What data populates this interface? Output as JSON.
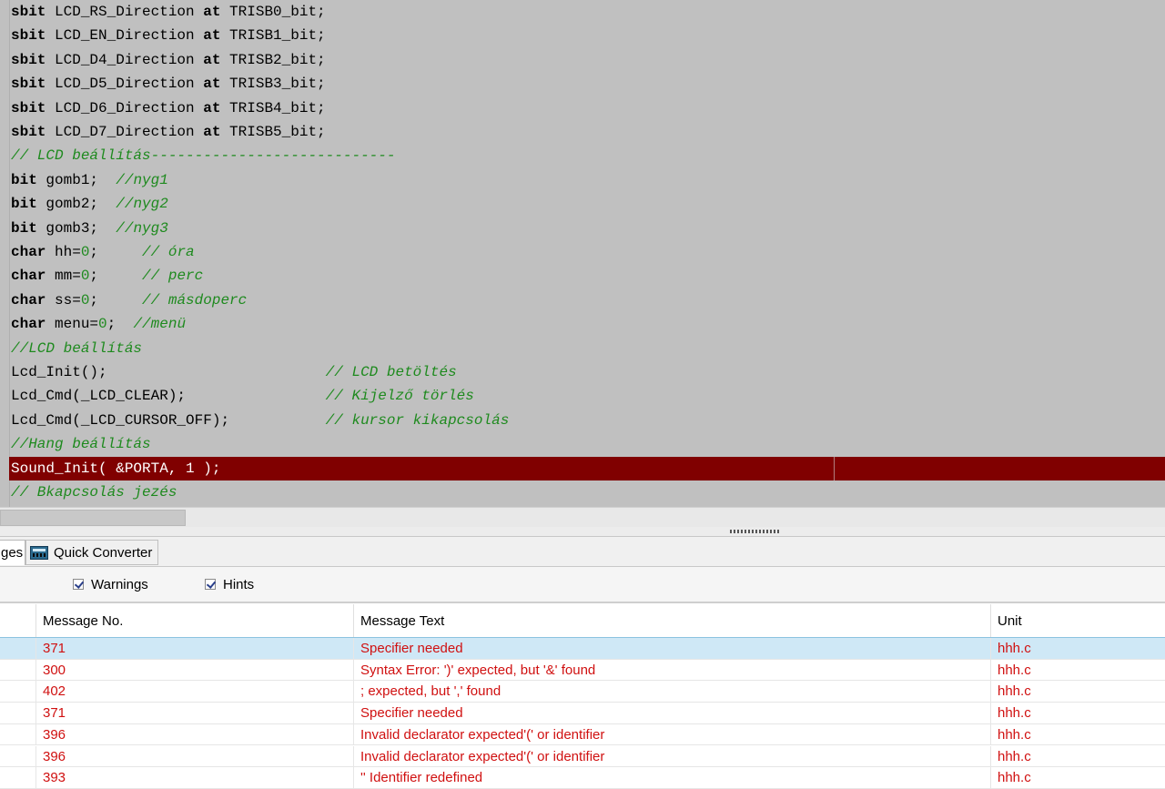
{
  "editor": {
    "lines": [
      [
        {
          "t": "sbit",
          "c": "kw"
        },
        {
          "t": " LCD_RS_Direction "
        },
        {
          "t": "at",
          "c": "kw"
        },
        {
          "t": " TRISB0_bit;"
        }
      ],
      [
        {
          "t": "sbit",
          "c": "kw"
        },
        {
          "t": " LCD_EN_Direction "
        },
        {
          "t": "at",
          "c": "kw"
        },
        {
          "t": " TRISB1_bit;"
        }
      ],
      [
        {
          "t": "sbit",
          "c": "kw"
        },
        {
          "t": " LCD_D4_Direction "
        },
        {
          "t": "at",
          "c": "kw"
        },
        {
          "t": " TRISB2_bit;"
        }
      ],
      [
        {
          "t": "sbit",
          "c": "kw"
        },
        {
          "t": " LCD_D5_Direction "
        },
        {
          "t": "at",
          "c": "kw"
        },
        {
          "t": " TRISB3_bit;"
        }
      ],
      [
        {
          "t": "sbit",
          "c": "kw"
        },
        {
          "t": " LCD_D6_Direction "
        },
        {
          "t": "at",
          "c": "kw"
        },
        {
          "t": " TRISB4_bit;"
        }
      ],
      [
        {
          "t": "sbit",
          "c": "kw"
        },
        {
          "t": " LCD_D7_Direction "
        },
        {
          "t": "at",
          "c": "kw"
        },
        {
          "t": " TRISB5_bit;"
        }
      ],
      [
        {
          "t": "// LCD beállítás----------------------------",
          "c": "cm"
        }
      ],
      [
        {
          "t": "bit",
          "c": "kw"
        },
        {
          "t": " gomb1;  "
        },
        {
          "t": "//nyg1",
          "c": "cm"
        }
      ],
      [
        {
          "t": "bit",
          "c": "kw"
        },
        {
          "t": " gomb2;  "
        },
        {
          "t": "//nyg2",
          "c": "cm"
        }
      ],
      [
        {
          "t": "bit",
          "c": "kw"
        },
        {
          "t": " gomb3;  "
        },
        {
          "t": "//nyg3",
          "c": "cm"
        }
      ],
      [
        {
          "t": "char",
          "c": "kw"
        },
        {
          "t": " hh="
        },
        {
          "t": "0",
          "c": "num"
        },
        {
          "t": ";     "
        },
        {
          "t": "// óra",
          "c": "cm"
        }
      ],
      [
        {
          "t": "char",
          "c": "kw"
        },
        {
          "t": " mm="
        },
        {
          "t": "0",
          "c": "num"
        },
        {
          "t": ";     "
        },
        {
          "t": "// perc",
          "c": "cm"
        }
      ],
      [
        {
          "t": "char",
          "c": "kw"
        },
        {
          "t": " ss="
        },
        {
          "t": "0",
          "c": "num"
        },
        {
          "t": ";     "
        },
        {
          "t": "// másdoperc",
          "c": "cm"
        }
      ],
      [
        {
          "t": "char",
          "c": "kw"
        },
        {
          "t": " menu="
        },
        {
          "t": "0",
          "c": "num"
        },
        {
          "t": ";  "
        },
        {
          "t": "//menü",
          "c": "cm"
        }
      ],
      [
        {
          "t": "//LCD beállítás",
          "c": "cm"
        }
      ],
      [
        {
          "t": "Lcd_Init();                         "
        },
        {
          "t": "// LCD betöltés",
          "c": "cm"
        }
      ],
      [
        {
          "t": "Lcd_Cmd(_LCD_CLEAR);                "
        },
        {
          "t": "// Kijelző törlés",
          "c": "cm"
        }
      ],
      [
        {
          "t": "Lcd_Cmd(_LCD_CURSOR_OFF);           "
        },
        {
          "t": "// kursor kikapcsolás",
          "c": "cm"
        }
      ],
      [
        {
          "t": "//Hang beállítás",
          "c": "cm"
        }
      ],
      [
        {
          "t": "Sound_Init( &PORTA, 1 );"
        }
      ],
      [
        {
          "t": "// Bkapcsolás jezés",
          "c": "cm"
        }
      ]
    ],
    "active_line": 19
  },
  "tabs": {
    "messages_label": "ges",
    "quick_converter_label": "Quick Converter"
  },
  "filters": {
    "warnings_label": "Warnings",
    "hints_label": "Hints"
  },
  "messages": {
    "columns": [
      "Message No.",
      "Message Text",
      "Unit"
    ],
    "rows": [
      {
        "no": "371",
        "text": "Specifier needed",
        "unit": "hhh.c"
      },
      {
        "no": "300",
        "text": "Syntax Error: ')' expected,  but '&' found",
        "unit": "hhh.c"
      },
      {
        "no": "402",
        "text": "; expected, but ',' found",
        "unit": "hhh.c"
      },
      {
        "no": "371",
        "text": "Specifier needed",
        "unit": "hhh.c"
      },
      {
        "no": "396",
        "text": "Invalid declarator expected'(' or identifier",
        "unit": "hhh.c"
      },
      {
        "no": "396",
        "text": "Invalid declarator expected'(' or identifier",
        "unit": "hhh.c"
      },
      {
        "no": "393",
        "text": "'' Identifier redefined",
        "unit": "hhh.c"
      }
    ],
    "selected_row": 0
  },
  "colors": {
    "editor_bg": "#c0c0c0",
    "active_line_bg": "#800000",
    "comment": "#1e8a1e",
    "error_text": "#d01010",
    "selected_row_bg": "#cfe8f6"
  }
}
